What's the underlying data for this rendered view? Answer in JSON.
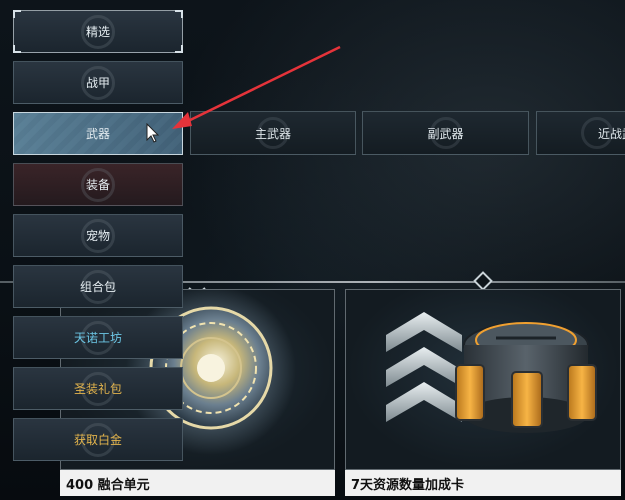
{
  "sidebar": {
    "items": [
      {
        "label": "精选",
        "state": "top"
      },
      {
        "label": "战甲",
        "state": "normal"
      },
      {
        "label": "武器",
        "state": "active"
      },
      {
        "label": "装备",
        "state": "red"
      },
      {
        "label": "宠物",
        "state": "normal"
      },
      {
        "label": "组合包",
        "state": "normal"
      },
      {
        "label": "天诺工坊",
        "state": "cyan"
      },
      {
        "label": "圣装礼包",
        "state": "gold"
      },
      {
        "label": "获取白金",
        "state": "gold"
      }
    ]
  },
  "subtabs": [
    {
      "label": "主武器"
    },
    {
      "label": "副武器"
    },
    {
      "label": "近战武"
    }
  ],
  "cards": [
    {
      "title": "400 融合单元"
    },
    {
      "title": "7天资源数量加成卡"
    }
  ],
  "colors": {
    "annotation_arrow": "#e5333a",
    "cyan_label": "#6cc7e6",
    "gold_label": "#e3b44c",
    "orange_accent": "#f0a030"
  }
}
